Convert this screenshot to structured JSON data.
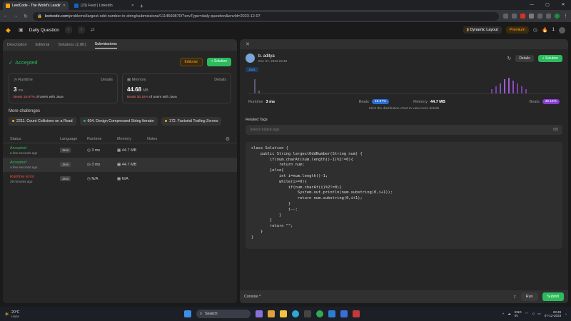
{
  "browser": {
    "tabs": [
      {
        "title": "LeetCode - The World's Leadin...",
        "active": true,
        "favicon_color": "#ffa116"
      },
      {
        "title": "(23) Feed | LinkedIn",
        "active": false,
        "favicon_color": "#0a66c2"
      }
    ],
    "new_tab": "+",
    "url_host": "leetcode.com",
    "url_path": "/problems/largest-odd-number-in-string/submissions/1114560870/?envType=daily-question&envId=2023-12-07"
  },
  "header": {
    "title": "Daily Question",
    "dynamic_layout": "Dynamic Layout",
    "premium": "Premium",
    "streak": "1"
  },
  "left": {
    "tabs": [
      "Description",
      "Editorial",
      "Solutions (2.8K)",
      "Submissions"
    ],
    "status": "Accepted",
    "editorial_btn": "Editorial",
    "solution_btn": "+ Solution",
    "runtime": {
      "label": "Runtime",
      "details": "Details",
      "value": "3",
      "unit": "ms",
      "beats_pct": "Beats 19.97%",
      "beats_rest": "of users with Java"
    },
    "memory": {
      "label": "Memory",
      "details": "Details",
      "value": "44.68",
      "unit": "MB",
      "beats_pct": "Beats 36.16%",
      "beats_rest": "of users with Java"
    },
    "more_title": "More challenges",
    "challenges": [
      {
        "label": "2211. Count Collisions on a Road",
        "dot": "#ffb800"
      },
      {
        "label": "604. Design Compressed String Iterator",
        "dot": "#00b8a3"
      },
      {
        "label": "172. Factorial Trailing Zeroes",
        "dot": "#ffb800"
      }
    ],
    "table": {
      "headers": [
        "Status",
        "Language",
        "Runtime",
        "Memory",
        "Notes"
      ],
      "rows": [
        {
          "status": "Accepted",
          "status_color": "#2cbb5d",
          "time": "a few seconds ago",
          "lang": "Java",
          "runtime": "3 ms",
          "memory": "44.7 MB"
        },
        {
          "status": "Accepted",
          "status_color": "#2cbb5d",
          "time": "a few seconds ago",
          "lang": "Java",
          "runtime": "3 ms",
          "memory": "44.7 MB"
        },
        {
          "status": "Runtime Error",
          "status_color": "#ef4743",
          "time": "39 minutes ago",
          "lang": "Java",
          "runtime": "N/A",
          "memory": "N/A"
        }
      ]
    }
  },
  "right": {
    "close": "✕",
    "user": "b. aditya",
    "date": "Dec 07, 2023 23:48",
    "details_btn": "Details",
    "solution_btn": "+ Solution",
    "lang_tag": "Java",
    "runtime_label": "Runtime",
    "runtime_value": "3 ms",
    "beats_label": "Beats",
    "runtime_beats": "19.97%",
    "memory_label": "Memory",
    "memory_value": "44.7 MB",
    "memory_beats": "36.16%",
    "hint": "Click the distribution chart to view more details",
    "related_label": "Related Tags",
    "related_placeholder": "Select related tags",
    "related_count": "0/5",
    "code": "class Solution {\n    public String largestOddNumber(String num) {\n        if(num.charAt(num.length()-1)%2!=0){\n            return num;\n        }else{\n            int i=num.length()-1;\n            while(i>=0){\n                if(num.charAt(i)%2!=0){\n                    System.out.println(num.substring(0,i+1));\n                    return num.substring(0,i+1);\n                }\n                i--;\n            }\n        }\n        return \"\";\n    }\n}",
    "console": "Console ^",
    "run": "Run",
    "submit": "Submit"
  },
  "taskbar": {
    "temp": "20°C",
    "condition": "Haze",
    "search": "Search",
    "lang1": "ENG",
    "lang2": "IN",
    "time": "23:49",
    "date": "07-12-2023"
  }
}
